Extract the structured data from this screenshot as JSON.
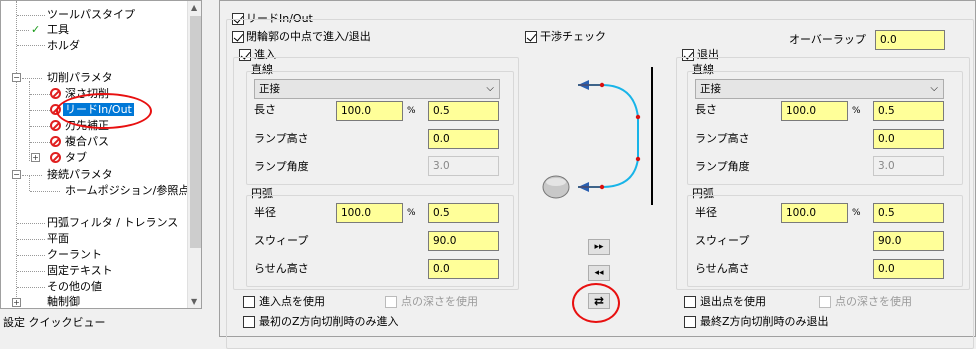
{
  "tree": {
    "items": [
      {
        "label": "ツールパスタイプ"
      },
      {
        "label": "工具",
        "mark": "✓"
      },
      {
        "label": "ホルダ"
      },
      {
        "label": "切削パラメタ",
        "toggle": "−"
      },
      {
        "label": "深さ切削"
      },
      {
        "label": "リードIn/Out"
      },
      {
        "label": "刃先補正"
      },
      {
        "label": "複合パス"
      },
      {
        "label": "タブ",
        "toggle": "+"
      },
      {
        "label": "接続パラメタ",
        "toggle": "−"
      },
      {
        "label": "ホームポジション/参照点"
      },
      {
        "label": "円弧フィルタ / トレランス"
      },
      {
        "label": "平面"
      },
      {
        "label": "クーラント"
      },
      {
        "label": "固定テキスト"
      },
      {
        "label": "その他の値"
      },
      {
        "label": "軸制御"
      }
    ]
  },
  "status": {
    "label": "設定 クイックビュー"
  },
  "lead": {
    "title": "リードIn/Out",
    "midpoint": "閉輪郭の中点で進入/退出",
    "gouge": "干渉チェック",
    "overlap_label": "オーバーラップ",
    "overlap": "0.0",
    "entry": {
      "title": "進入",
      "line_group": "直線",
      "type": "正接",
      "length_label": "長さ",
      "length_pct": "100.0",
      "pct": "%",
      "length": "0.5",
      "ramp_h_label": "ランプ高さ",
      "ramp_h": "0.0",
      "ramp_a_label": "ランプ角度",
      "ramp_a": "3.0",
      "arc_group": "円弧",
      "radius_label": "半径",
      "radius_pct": "100.0",
      "radius": "0.5",
      "sweep_label": "スウィープ",
      "sweep": "90.0",
      "helix_label": "らせん高さ",
      "helix": "0.0",
      "use_point": "進入点を使用",
      "use_depth": "点の深さを使用",
      "first_z": "最初のZ方向切削時のみ進入"
    },
    "exit": {
      "title": "退出",
      "line_group": "直線",
      "type": "正接",
      "length_label": "長さ",
      "length_pct": "100.0",
      "pct": "%",
      "length": "0.5",
      "ramp_h_label": "ランプ高さ",
      "ramp_h": "0.0",
      "ramp_a_label": "ランプ角度",
      "ramp_a": "3.0",
      "arc_group": "円弧",
      "radius_label": "半径",
      "radius_pct": "100.0",
      "radius": "0.5",
      "sweep_label": "スウィープ",
      "sweep": "90.0",
      "helix_label": "らせん高さ",
      "helix": "0.0",
      "use_point": "退出点を使用",
      "use_depth": "点の深さを使用",
      "last_z": "最終Z方向切削時のみ退出"
    },
    "buttons": {
      "forward": "▸▸",
      "back": "◂◂",
      "swap": "⇄"
    }
  },
  "colors": {
    "highlight": "#ffff99",
    "selection": "#0078d7",
    "annotation": "#e81010"
  }
}
